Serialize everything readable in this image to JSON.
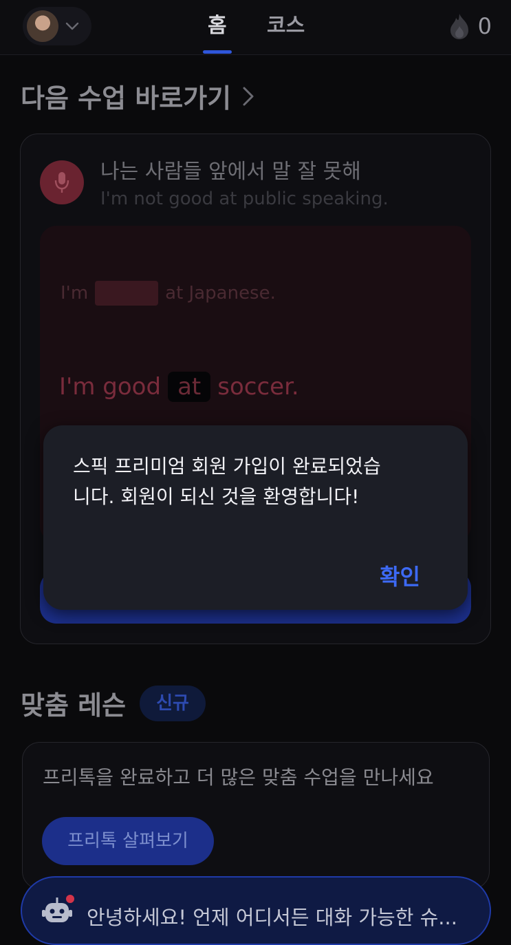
{
  "header": {
    "tabs": [
      {
        "label": "홈",
        "active": true
      },
      {
        "label": "코스",
        "active": false
      }
    ],
    "streak_count": "0",
    "streak_icon": "flame-icon"
  },
  "next_lesson": {
    "section_title": "다음 수업 바로가기",
    "korean_sentence": "나는 사람들 앞에서 말 잘 못해",
    "english_sentence": "I'm not good at public speaking.",
    "example_1": {
      "before": "I'm",
      "after": "at Japanese."
    },
    "example_2": {
      "before": "I'm good",
      "highlight": "at",
      "after": "soccer."
    }
  },
  "modal": {
    "message": "스픽 프리미엄 회원 가입이 완료되었습니다. 회원이 되신 것을 환영합니다!",
    "ok_label": "확인"
  },
  "custom_lessons": {
    "title": "맞춤 레슨",
    "badge": "신규",
    "description": "프리톡을 완료하고 더 많은 맞춤 수업을 만나세요",
    "button_label": "프리톡 살펴보기"
  },
  "chat_bar": {
    "text": "안녕하세요! 언제 어디서든 대화 가능한 슈..."
  },
  "colors": {
    "accent": "#2f56d9",
    "modal_ok": "#3d6af5",
    "background": "#0a0a0c",
    "notification_dot": "#d3344a"
  }
}
